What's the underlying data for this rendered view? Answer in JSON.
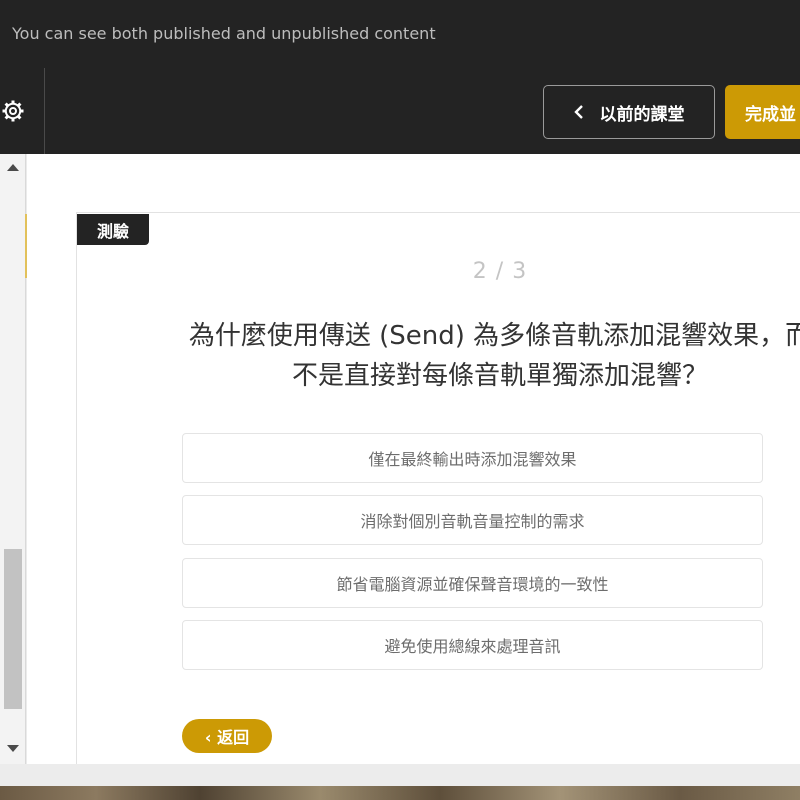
{
  "notice": {
    "text": "You can see both published and unpublished content"
  },
  "toolbar": {
    "settings_icon": "gear-icon",
    "prev_label": "以前的課堂",
    "prev_icon": "chevron-left-icon",
    "complete_label": "完成並"
  },
  "quiz": {
    "tag": "測驗",
    "progress": "2 / 3",
    "question_line1": "為什麼使用傳送 (Send) 為多條音軌添加混響效果，而",
    "question_line2": "不是直接對每條音軌單獨添加混響？",
    "options": [
      {
        "label": "僅在最終輸出時添加混響效果"
      },
      {
        "label": "消除對個別音軌音量控制的需求"
      },
      {
        "label": "節省電腦資源並確保聲音環境的一致性"
      },
      {
        "label": "避免使用總線來處理音訊"
      }
    ],
    "back_label": "‹ 返回"
  },
  "colors": {
    "accent": "#cc9a05",
    "dark_bar": "#232323"
  }
}
